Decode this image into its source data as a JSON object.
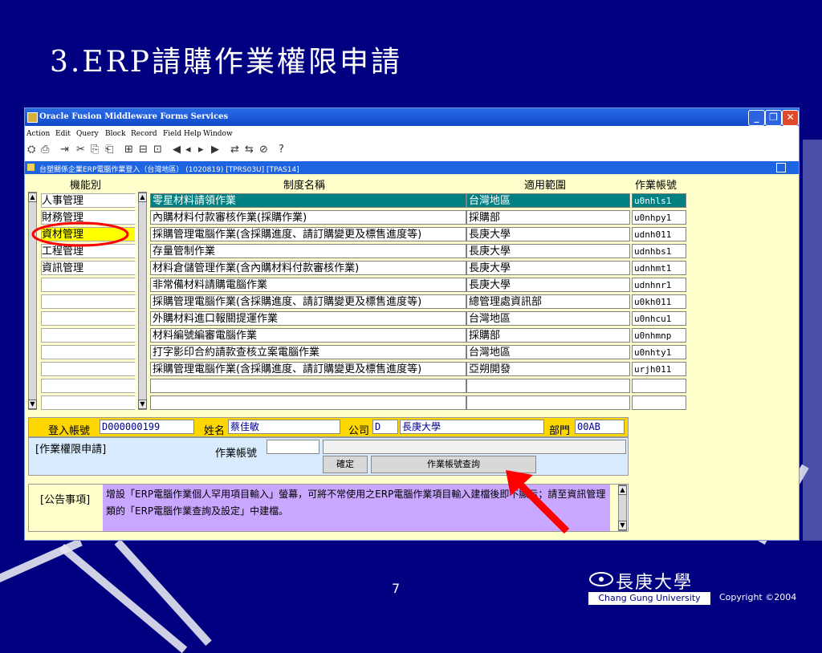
{
  "slide": {
    "title": "3.ERP請購作業權限申請",
    "page_number": "7",
    "logo_name": "長庚大學",
    "logo_english": "Chang Gung University",
    "copyright": "Copyright ©2004"
  },
  "window": {
    "title": "Oracle Fusion Middleware Forms Services",
    "menu": [
      "Action",
      "Edit",
      "Query",
      "Block",
      "Record",
      "Field",
      "Help",
      "Window"
    ],
    "status_title": "台塑關係企業ERP電腦作業登入（台灣地區） (1020819)  [TPRS03U]  [TPAS14]"
  },
  "form": {
    "headers": {
      "category": "機能別",
      "name": "制度名稱",
      "scope": "適用範圍",
      "code": "作業帳號"
    },
    "categories": [
      "人事管理",
      "財務管理",
      "資材管理",
      "工程管理",
      "資訊管理"
    ],
    "selected_category": "資材管理",
    "rows": [
      {
        "name": "零星材料請領作業",
        "scope": "台灣地區",
        "code": "u0nhls1"
      },
      {
        "name": "內購材料付款審核作業(採購作業)",
        "scope": "採購部",
        "code": "u0nhpy1"
      },
      {
        "name": "採購管理電腦作業(含採購進度、請訂購變更及標售進度等)",
        "scope": "長庚大學",
        "code": "udnh011"
      },
      {
        "name": "存量管制作業",
        "scope": "長庚大學",
        "code": "udnhbs1"
      },
      {
        "name": "材料倉儲管理作業(含內購材料付款審核作業)",
        "scope": "長庚大學",
        "code": "udnhmt1"
      },
      {
        "name": "非常備材料請購電腦作業",
        "scope": "長庚大學",
        "code": "udnhnr1"
      },
      {
        "name": "採購管理電腦作業(含採購進度、請訂購變更及標售進度等)",
        "scope": "總管理處資訊部",
        "code": "u0kh011"
      },
      {
        "name": "外購材料進口報關提運作業",
        "scope": "台灣地區",
        "code": "u0nhcu1"
      },
      {
        "name": "材料編號編審電腦作業",
        "scope": "採購部",
        "code": "u0nhmnp"
      },
      {
        "name": "打字影印合約請款查核立案電腦作業",
        "scope": "台灣地區",
        "code": "u0nhty1"
      },
      {
        "name": "採購管理電腦作業(含採購進度、請訂購變更及標售進度等)",
        "scope": "亞朔開發",
        "code": "urjh011"
      }
    ],
    "info": {
      "login_label": "登入帳號",
      "login_value": "D000000199",
      "name_label": "姓名",
      "name_value": "蔡佳敏",
      "company_label": "公司",
      "company_code": "D",
      "company_name": "長庚大學",
      "dept_label": "部門",
      "dept_value": "00AB"
    },
    "apply": {
      "section_label": "[作業權限申請]",
      "account_label": "作業帳號",
      "account_value": "",
      "confirm_button": "確定",
      "query_button": "作業帳號查詢"
    },
    "notice": {
      "label": "[公告事項]",
      "text": "增設「ERP電腦作業個人罕用項目輸入」螢幕，可將不常使用之ERP電腦作業項目輸入建檔後即不顯示；請至資訊管理類的「ERP電腦作業查詢及設定」中建檔。"
    }
  },
  "colors": {
    "slide_bg": "#000080",
    "form_bg": "#ffffcc",
    "selected": "#ffff00",
    "row_highlight": "#008080",
    "annotation": "#ff0000"
  }
}
